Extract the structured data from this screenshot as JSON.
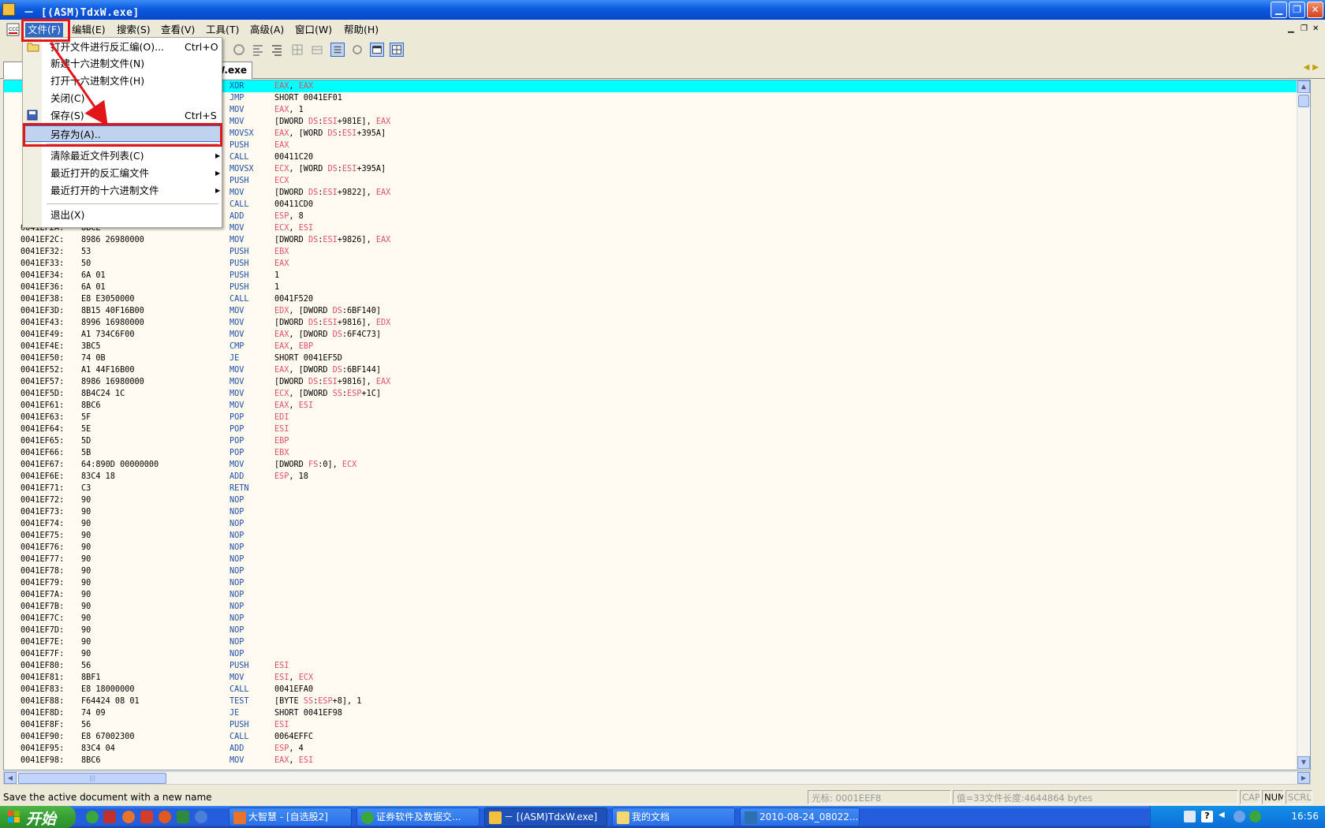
{
  "window": {
    "title": "－ [(ASM)TdxW.exe]",
    "controls": [
      "minimize",
      "maximize",
      "close"
    ]
  },
  "menubar": {
    "items": [
      "文件(F)",
      "编辑(E)",
      "搜索(S)",
      "查看(V)",
      "工具(T)",
      "高级(A)",
      "窗口(W)",
      "帮助(H)"
    ],
    "active": "文件(F)"
  },
  "tab": {
    "name": "W.exe"
  },
  "file_menu": {
    "items": [
      {
        "label": "打开文件进行反汇编(O)...",
        "shortcut": "Ctrl+O",
        "icon": "open-folder-icon"
      },
      {
        "label": "新建十六进制文件(N)",
        "shortcut": ""
      },
      {
        "label": "打开十六进制文件(H)",
        "shortcut": ""
      },
      {
        "label": "关闭(C)",
        "shortcut": ""
      },
      {
        "label": "保存(S)",
        "shortcut": "Ctrl+S",
        "icon": "save-icon"
      },
      {
        "label": "另存为(A)..",
        "shortcut": "",
        "highlighted": true
      },
      {
        "label": "清除最近文件列表(C)",
        "submenu": true
      },
      {
        "label": "最近打开的反汇编文件",
        "submenu": true
      },
      {
        "label": "最近打开的十六进制文件",
        "submenu": true
      },
      {
        "label": "退出(X)"
      }
    ]
  },
  "disasm": {
    "rows": [
      {
        "addr": "",
        "hex": "",
        "mn": "XOR",
        "op": "EAX, EAX",
        "selected": true
      },
      {
        "addr": "",
        "hex": "",
        "mn": "JMP",
        "op": "SHORT 0041EF01"
      },
      {
        "addr": "",
        "hex": "",
        "mn": "MOV",
        "op": "EAX, 1"
      },
      {
        "addr": "",
        "hex": "",
        "mn": "MOV",
        "op": "[DWORD DS:ESI+981E], EAX"
      },
      {
        "addr": "",
        "hex": "",
        "mn": "MOVSX",
        "op": "EAX, [WORD DS:ESI+395A]"
      },
      {
        "addr": "",
        "hex": "",
        "mn": "PUSH",
        "op": "EAX"
      },
      {
        "addr": "",
        "hex": "",
        "mn": "CALL",
        "op": "00411C20"
      },
      {
        "addr": "",
        "hex": "",
        "mn": "MOVSX",
        "op": "ECX, [WORD DS:ESI+395A]"
      },
      {
        "addr": "",
        "hex": "",
        "mn": "PUSH",
        "op": "ECX"
      },
      {
        "addr": "",
        "hex": "",
        "mn": "MOV",
        "op": "[DWORD DS:ESI+9822], EAX"
      },
      {
        "addr": "",
        "hex": "",
        "mn": "CALL",
        "op": "00411CD0"
      },
      {
        "addr": "",
        "hex": "",
        "mn": "ADD",
        "op": "ESP, 8"
      },
      {
        "addr": "0041EF2A:",
        "hex": "8BCE",
        "mn": "MOV",
        "op": "ECX, ESI"
      },
      {
        "addr": "0041EF2C:",
        "hex": "8986 26980000",
        "mn": "MOV",
        "op": "[DWORD DS:ESI+9826], EAX"
      },
      {
        "addr": "0041EF32:",
        "hex": "53",
        "mn": "PUSH",
        "op": "EBX"
      },
      {
        "addr": "0041EF33:",
        "hex": "50",
        "mn": "PUSH",
        "op": "EAX"
      },
      {
        "addr": "0041EF34:",
        "hex": "6A 01",
        "mn": "PUSH",
        "op": "1"
      },
      {
        "addr": "0041EF36:",
        "hex": "6A 01",
        "mn": "PUSH",
        "op": "1"
      },
      {
        "addr": "0041EF38:",
        "hex": "E8 E3050000",
        "mn": "CALL",
        "op": "0041F520"
      },
      {
        "addr": "0041EF3D:",
        "hex": "8B15 40F16B00",
        "mn": "MOV",
        "op": "EDX, [DWORD DS:6BF140]"
      },
      {
        "addr": "0041EF43:",
        "hex": "8996 16980000",
        "mn": "MOV",
        "op": "[DWORD DS:ESI+9816], EDX"
      },
      {
        "addr": "0041EF49:",
        "hex": "A1 734C6F00",
        "mn": "MOV",
        "op": "EAX, [DWORD DS:6F4C73]"
      },
      {
        "addr": "0041EF4E:",
        "hex": "3BC5",
        "mn": "CMP",
        "op": "EAX, EBP"
      },
      {
        "addr": "0041EF50:",
        "hex": "74 0B",
        "mn": "JE",
        "op": "SHORT 0041EF5D"
      },
      {
        "addr": "0041EF52:",
        "hex": "A1 44F16B00",
        "mn": "MOV",
        "op": "EAX, [DWORD DS:6BF144]"
      },
      {
        "addr": "0041EF57:",
        "hex": "8986 16980000",
        "mn": "MOV",
        "op": "[DWORD DS:ESI+9816], EAX"
      },
      {
        "addr": "0041EF5D:",
        "hex": "8B4C24 1C",
        "mn": "MOV",
        "op": "ECX, [DWORD SS:ESP+1C]"
      },
      {
        "addr": "0041EF61:",
        "hex": "8BC6",
        "mn": "MOV",
        "op": "EAX, ESI"
      },
      {
        "addr": "0041EF63:",
        "hex": "5F",
        "mn": "POP",
        "op": "EDI"
      },
      {
        "addr": "0041EF64:",
        "hex": "5E",
        "mn": "POP",
        "op": "ESI"
      },
      {
        "addr": "0041EF65:",
        "hex": "5D",
        "mn": "POP",
        "op": "EBP"
      },
      {
        "addr": "0041EF66:",
        "hex": "5B",
        "mn": "POP",
        "op": "EBX"
      },
      {
        "addr": "0041EF67:",
        "hex": "64:890D 00000000",
        "mn": "MOV",
        "op": "[DWORD FS:0], ECX"
      },
      {
        "addr": "0041EF6E:",
        "hex": "83C4 18",
        "mn": "ADD",
        "op": "ESP, 18"
      },
      {
        "addr": "0041EF71:",
        "hex": "C3",
        "mn": "RETN",
        "op": ""
      },
      {
        "addr": "0041EF72:",
        "hex": "90",
        "mn": "NOP",
        "op": ""
      },
      {
        "addr": "0041EF73:",
        "hex": "90",
        "mn": "NOP",
        "op": ""
      },
      {
        "addr": "0041EF74:",
        "hex": "90",
        "mn": "NOP",
        "op": ""
      },
      {
        "addr": "0041EF75:",
        "hex": "90",
        "mn": "NOP",
        "op": ""
      },
      {
        "addr": "0041EF76:",
        "hex": "90",
        "mn": "NOP",
        "op": ""
      },
      {
        "addr": "0041EF77:",
        "hex": "90",
        "mn": "NOP",
        "op": ""
      },
      {
        "addr": "0041EF78:",
        "hex": "90",
        "mn": "NOP",
        "op": ""
      },
      {
        "addr": "0041EF79:",
        "hex": "90",
        "mn": "NOP",
        "op": ""
      },
      {
        "addr": "0041EF7A:",
        "hex": "90",
        "mn": "NOP",
        "op": ""
      },
      {
        "addr": "0041EF7B:",
        "hex": "90",
        "mn": "NOP",
        "op": ""
      },
      {
        "addr": "0041EF7C:",
        "hex": "90",
        "mn": "NOP",
        "op": ""
      },
      {
        "addr": "0041EF7D:",
        "hex": "90",
        "mn": "NOP",
        "op": ""
      },
      {
        "addr": "0041EF7E:",
        "hex": "90",
        "mn": "NOP",
        "op": ""
      },
      {
        "addr": "0041EF7F:",
        "hex": "90",
        "mn": "NOP",
        "op": ""
      },
      {
        "addr": "0041EF80:",
        "hex": "56",
        "mn": "PUSH",
        "op": "ESI"
      },
      {
        "addr": "0041EF81:",
        "hex": "8BF1",
        "mn": "MOV",
        "op": "ESI, ECX"
      },
      {
        "addr": "0041EF83:",
        "hex": "E8 18000000",
        "mn": "CALL",
        "op": "0041EFA0"
      },
      {
        "addr": "0041EF88:",
        "hex": "F64424 08 01",
        "mn": "TEST",
        "op": "[BYTE SS:ESP+8], 1"
      },
      {
        "addr": "0041EF8D:",
        "hex": "74 09",
        "mn": "JE",
        "op": "SHORT 0041EF98"
      },
      {
        "addr": "0041EF8F:",
        "hex": "56",
        "mn": "PUSH",
        "op": "ESI"
      },
      {
        "addr": "0041EF90:",
        "hex": "E8 67002300",
        "mn": "CALL",
        "op": "0064EFFC"
      },
      {
        "addr": "0041EF95:",
        "hex": "83C4 04",
        "mn": "ADD",
        "op": "ESP, 4"
      },
      {
        "addr": "0041EF98:",
        "hex": "8BC6",
        "mn": "MOV",
        "op": "EAX, ESI"
      }
    ]
  },
  "statusbar": {
    "message": "Save the active document with a new name",
    "cursor": "光标: 0001EEF8",
    "value": "值=33文件长度:4644864 bytes",
    "cap": "CAP",
    "num": "NUM",
    "scrl": "SCRL"
  },
  "taskbar": {
    "start": "开始",
    "tasks": [
      "大智慧 - [自选股2]",
      "证券软件及数据交...",
      "－ [(ASM)TdxW.exe]",
      "我的文档",
      "2010-08-24_08022..."
    ],
    "active_task": "－ [(ASM)TdxW.exe]",
    "clock": "16:56"
  },
  "colors": {
    "selection": "#00FFFF",
    "mnemonic": "#1B4FA8",
    "register": "#E0506A",
    "annotation": "#E2151B"
  }
}
